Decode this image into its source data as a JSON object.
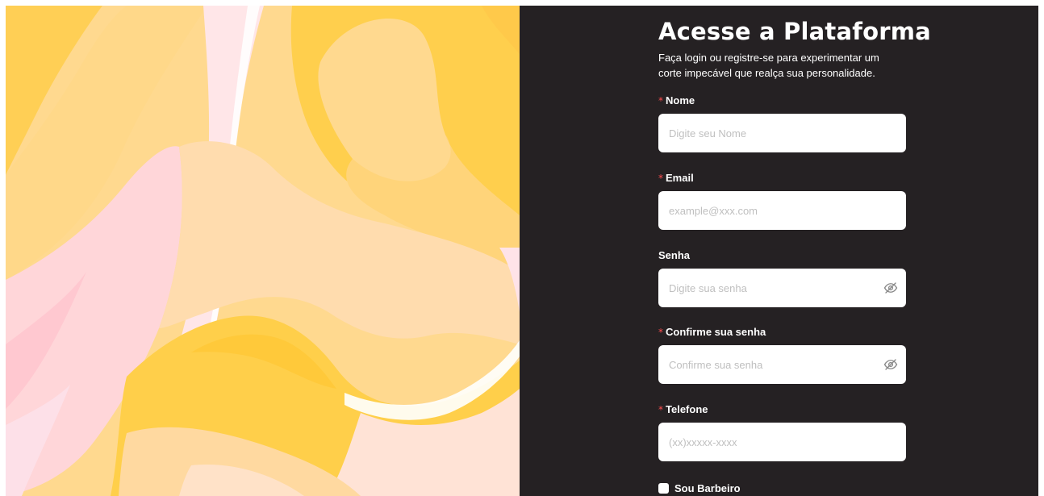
{
  "form": {
    "title": "Acesse a Plataforma",
    "subtitle": "Faça login ou registre-se para experimentar um corte impecável que realça sua personalidade.",
    "required_mark": "*",
    "fields": {
      "nome": {
        "label": "Nome",
        "required": true,
        "placeholder": "Digite seu Nome",
        "value": ""
      },
      "email": {
        "label": "Email",
        "required": true,
        "placeholder": "example@xxx.com",
        "value": ""
      },
      "senha": {
        "label": "Senha",
        "required": false,
        "placeholder": "Digite sua senha",
        "value": ""
      },
      "confirme": {
        "label": "Confirme sua senha",
        "required": true,
        "placeholder": "Confirme sua senha",
        "value": ""
      },
      "telefone": {
        "label": "Telefone",
        "required": true,
        "placeholder": "(xx)xxxxx-xxxx",
        "value": ""
      }
    },
    "barbeiro": {
      "label": "Sou Barbeiro",
      "checked": false
    }
  },
  "icons": {
    "password_toggle": "eye-invisible-icon"
  },
  "colors": {
    "panel_bg": "#252123",
    "required": "#ff4d4f",
    "art_yellow": "#ffd15a",
    "art_peach": "#ffd9a0",
    "art_pink": "#ffdfe6"
  }
}
